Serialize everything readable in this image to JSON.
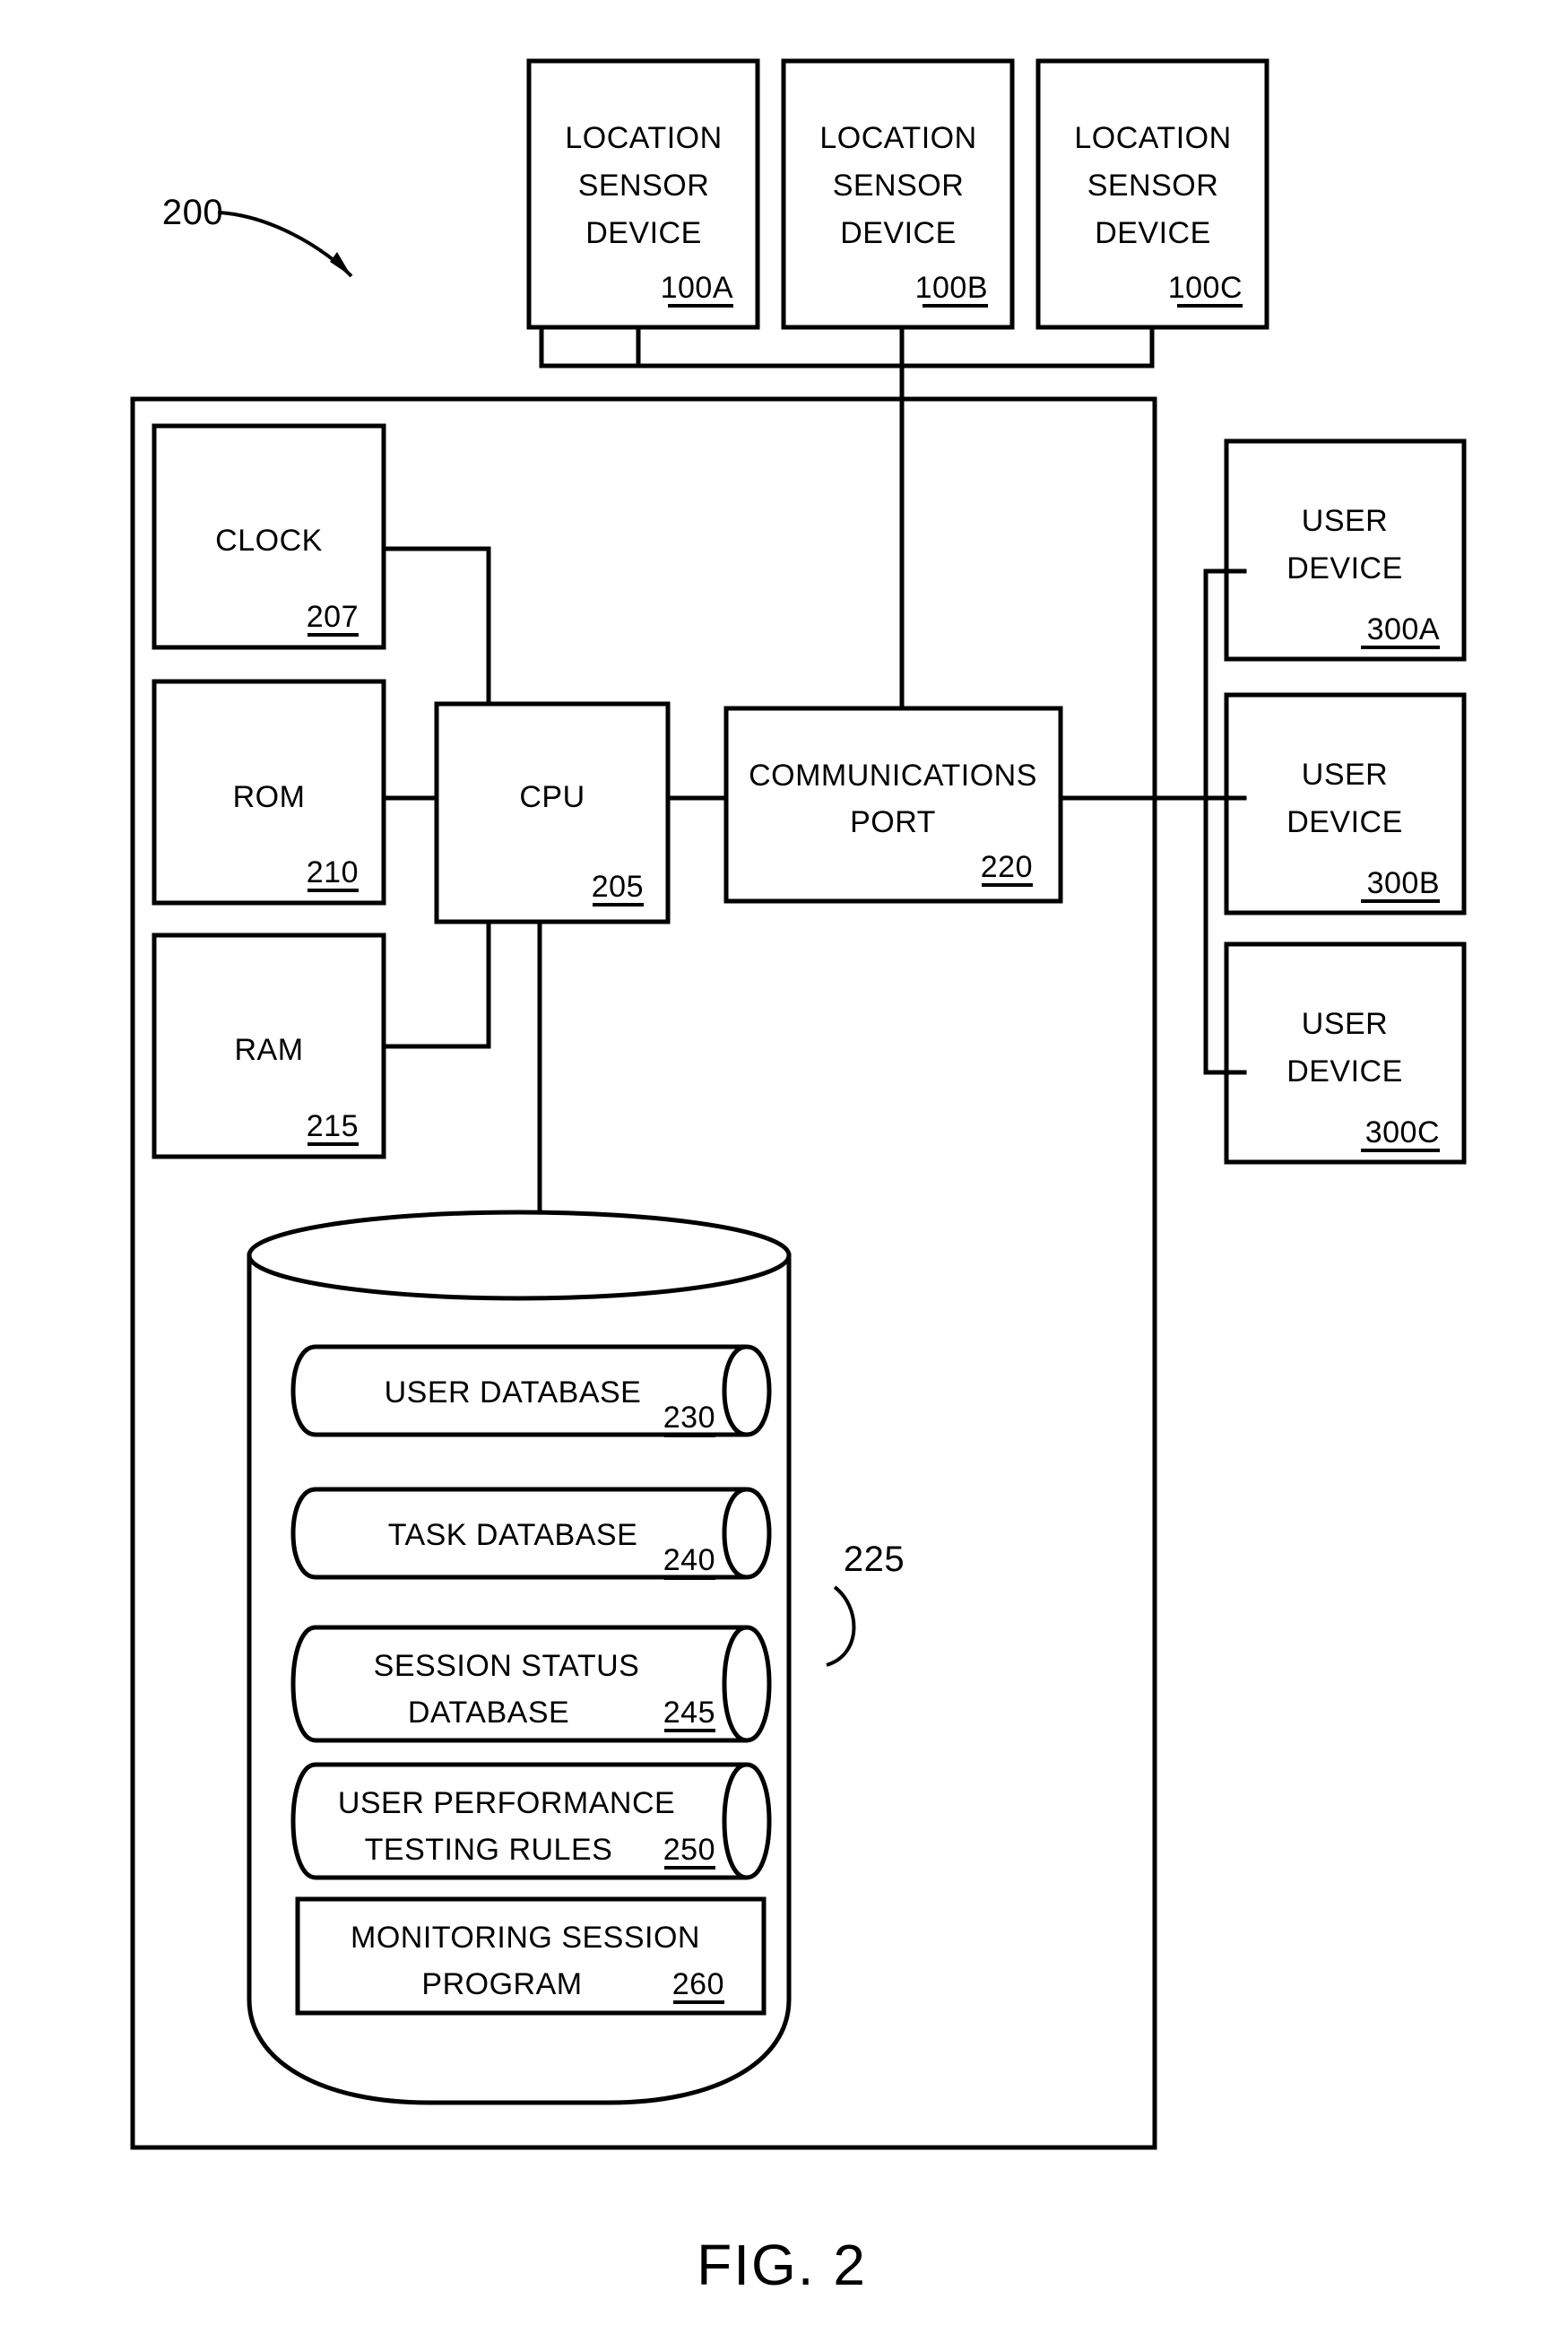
{
  "figure": {
    "caption": "FIG. 2",
    "system_ref": "200",
    "storage_ref": "225"
  },
  "sensors": [
    {
      "line1": "LOCATION",
      "line2": "SENSOR",
      "line3": "DEVICE",
      "ref": "100A"
    },
    {
      "line1": "LOCATION",
      "line2": "SENSOR",
      "line3": "DEVICE",
      "ref": "100B"
    },
    {
      "line1": "LOCATION",
      "line2": "SENSOR",
      "line3": "DEVICE",
      "ref": "100C"
    }
  ],
  "system": {
    "clock": {
      "label": "CLOCK",
      "ref": "207"
    },
    "rom": {
      "label": "ROM",
      "ref": "210"
    },
    "ram": {
      "label": "RAM",
      "ref": "215"
    },
    "cpu": {
      "label": "CPU",
      "ref": "205"
    },
    "comm_port": {
      "line1": "COMMUNICATIONS",
      "line2": "PORT",
      "ref": "220"
    }
  },
  "user_devices": [
    {
      "line1": "USER",
      "line2": "DEVICE",
      "ref": "300A"
    },
    {
      "line1": "USER",
      "line2": "DEVICE",
      "ref": "300B"
    },
    {
      "line1": "USER",
      "line2": "DEVICE",
      "ref": "300C"
    }
  ],
  "storage_items": [
    {
      "line1": "USER DATABASE",
      "line2": "",
      "ref": "230",
      "shape": "cylinder"
    },
    {
      "line1": "TASK DATABASE",
      "line2": "",
      "ref": "240",
      "shape": "cylinder"
    },
    {
      "line1": "SESSION STATUS",
      "line2": "DATABASE",
      "ref": "245",
      "shape": "cylinder"
    },
    {
      "line1": "USER PERFORMANCE",
      "line2": "TESTING RULES",
      "ref": "250",
      "shape": "cylinder"
    },
    {
      "line1": "MONITORING SESSION",
      "line2": "PROGRAM",
      "ref": "260",
      "shape": "rectangle"
    }
  ],
  "colors": {
    "ink": "#000000",
    "paper": "#ffffff"
  }
}
